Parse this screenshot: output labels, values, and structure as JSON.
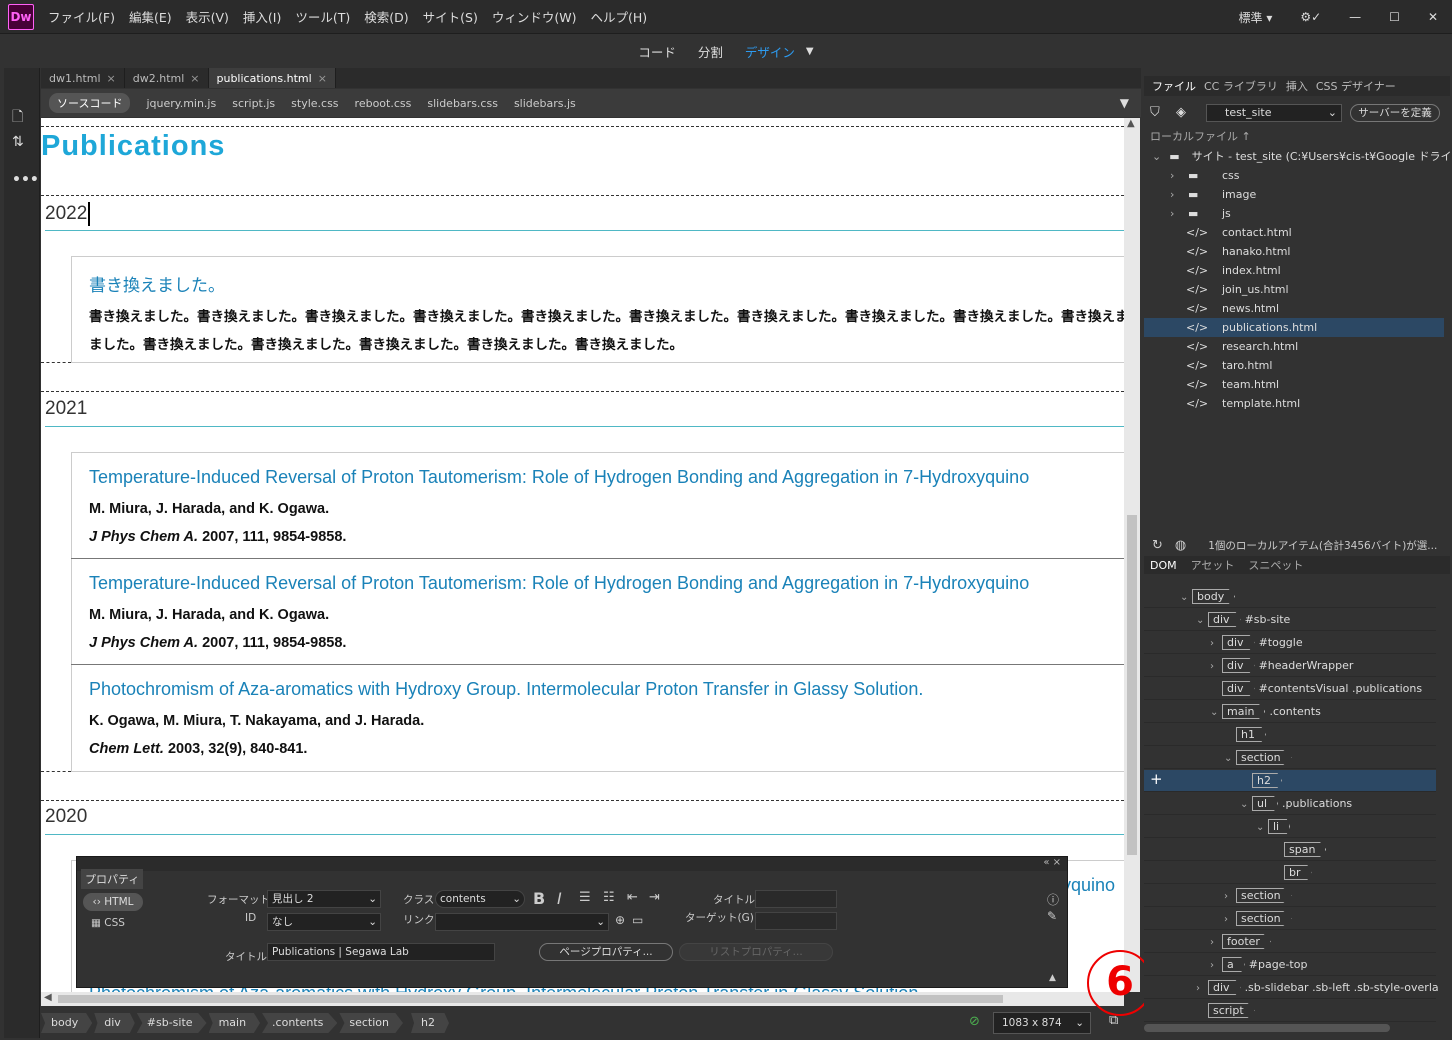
{
  "app": {
    "logo": "Dw"
  },
  "menu": [
    "ファイル(F)",
    "編集(E)",
    "表示(V)",
    "挿入(I)",
    "ツール(T)",
    "検索(D)",
    "サイト(S)",
    "ウィンドウ(W)",
    "ヘルプ(H)"
  ],
  "workspace": "標準",
  "views": {
    "code": "コード",
    "split": "分割",
    "design": "デザイン"
  },
  "doctabs": [
    "dw1.html",
    "dw2.html",
    "publications.html"
  ],
  "related": [
    "ソースコード",
    "jquery.min.js",
    "script.js",
    "style.css",
    "reboot.css",
    "slidebars.css",
    "slidebars.js"
  ],
  "page": {
    "title": "Publications",
    "y2022": "2022",
    "rewrite_title": "書き換えました。",
    "rewrite_line1": "書き換えました。書き換えました。書き換えました。書き換えました。書き換えました。書き換えました。書き換えました。書き換えました。書き換えました。書き換えま",
    "rewrite_line2": "ました。書き換えました。書き換えました。書き換えました。書き換えました。書き換えました。",
    "y2021": "2021",
    "pub1_title": "Temperature-Induced Reversal of Proton Tautomerism: Role of Hydrogen Bonding and Aggregation in 7-Hydroxyquino",
    "pub1_authors": "M. Miura, J. Harada, and K. Ogawa.",
    "pub1_journal": "J Phys Chem A.",
    "pub1_ref": " 2007, 111, 9854-9858.",
    "pub2_title": "Temperature-Induced Reversal of Proton Tautomerism: Role of Hydrogen Bonding and Aggregation in 7-Hydroxyquino",
    "pub2_authors": "M. Miura, J. Harada, and K. Ogawa.",
    "pub2_journal": "J Phys Chem A.",
    "pub2_ref": " 2007, 111, 9854-9858.",
    "pub3_title": "Photochromism of Aza-aromatics with Hydroxy Group. Intermolecular Proton Transfer in Glassy Solution.",
    "pub3_authors": "K. Ogawa, M. Miura, T. Nakayama, and J. Harada.",
    "pub3_journal": "Chem Lett.",
    "pub3_ref": " 2003, 32(9), 840-841.",
    "y2020": "2020",
    "peek_right": "yquino",
    "peek_bottom": "Photochromism of Aza-aromatics with Hydroxy Group. Intermolecular Proton Transfer in Glassy Solution."
  },
  "props": {
    "panel": "プロパティ",
    "html": "HTML",
    "css": "CSS",
    "format_label": "フォーマット",
    "format_value": "見出し 2",
    "id_label": "ID",
    "id_value": "なし",
    "class_label": "クラス",
    "class_value": "contents",
    "link_label": "リンク",
    "title_label": "タイトル",
    "target_label": "ターゲット(G)",
    "doc_title_label": "タイトル",
    "doc_title_value": "Publications | Segawa Lab",
    "page_props": "ページプロパティ...",
    "list_props": "リストプロパティ..."
  },
  "status": {
    "crumbs": [
      "body",
      "div",
      "#sb-site",
      "main",
      ".contents",
      "section",
      "h2"
    ],
    "size": "1083 x 874"
  },
  "panel_tabs": [
    "ファイル",
    "CC ライブラリ",
    "挿入",
    "CSS デザイナー"
  ],
  "site": {
    "select": "test_site",
    "server_btn": "サーバーを定義",
    "local_label": "ローカルファイル ↑",
    "root": "サイト - test_site (C:¥Users¥cis-t¥Google ドライ..."
  },
  "files": [
    "css",
    "image",
    "js",
    "contact.html",
    "hanako.html",
    "index.html",
    "join_us.html",
    "news.html",
    "publications.html",
    "research.html",
    "taro.html",
    "team.html",
    "template.html"
  ],
  "files_status": "1個のローカルアイテム(合計3456バイト)が選...",
  "dom_tabs": [
    "DOM",
    "アセット",
    "スニペット"
  ],
  "dom": [
    {
      "tag": "body",
      "name": ""
    },
    {
      "tag": "div",
      "name": "#sb-site"
    },
    {
      "tag": "div",
      "name": "#toggle"
    },
    {
      "tag": "div",
      "name": "#headerWrapper"
    },
    {
      "tag": "div",
      "name": "#contentsVisual .publications"
    },
    {
      "tag": "main",
      "name": ".contents"
    },
    {
      "tag": "h1",
      "name": ""
    },
    {
      "tag": "section",
      "name": ""
    },
    {
      "tag": "h2",
      "name": ""
    },
    {
      "tag": "ul",
      "name": ".publications"
    },
    {
      "tag": "li",
      "name": ""
    },
    {
      "tag": "span",
      "name": ""
    },
    {
      "tag": "br",
      "name": ""
    },
    {
      "tag": "section",
      "name": ""
    },
    {
      "tag": "section",
      "name": ""
    },
    {
      "tag": "footer",
      "name": ""
    },
    {
      "tag": "a",
      "name": "#page-top"
    },
    {
      "tag": "div",
      "name": ".sb-slidebar .sb-left .sb-style-overla"
    },
    {
      "tag": "script",
      "name": ""
    }
  ],
  "annotation": "6"
}
